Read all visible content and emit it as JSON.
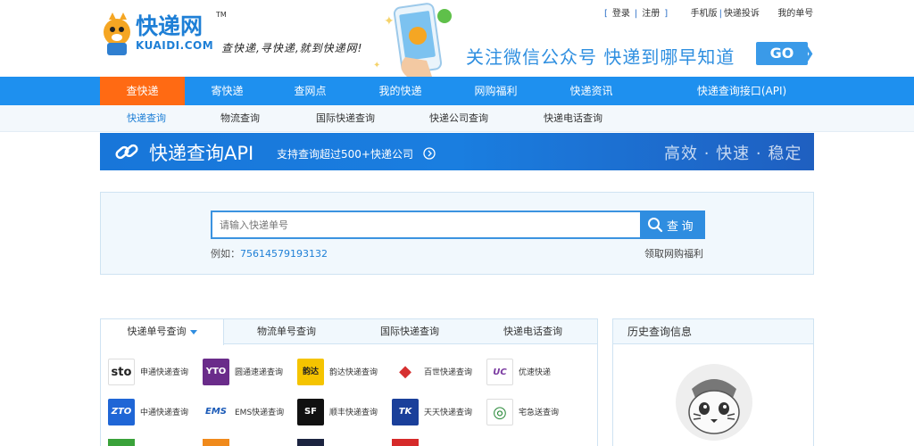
{
  "header": {
    "logo_text": "快递网",
    "logo_tm": "TM",
    "logo_sub": "KUAIDI.COM",
    "slogan": "查快递,寻快递,就到快递网!",
    "top_links": {
      "login": "登录",
      "register": "注册",
      "mobile": "手机版",
      "complaint": "快递投诉",
      "my_orders": "我的单号"
    },
    "banner_text": "关注微信公众号 快递到哪早知道",
    "banner_go": "GO"
  },
  "nav": [
    {
      "label": "查快递",
      "active": true
    },
    {
      "label": "寄快递"
    },
    {
      "label": "查网点"
    },
    {
      "label": "我的快递"
    },
    {
      "label": "网购福利"
    },
    {
      "label": "快递资讯"
    },
    {
      "label": "快递查询接口(API)"
    }
  ],
  "subnav": [
    {
      "label": "快递查询",
      "active": true
    },
    {
      "label": "物流查询"
    },
    {
      "label": "国际快递查询"
    },
    {
      "label": "快递公司查询"
    },
    {
      "label": "快递电话查询"
    }
  ],
  "api_banner": {
    "title": "快递查询API",
    "subtitle": "支持查询超过500+快递公司",
    "right_text": "高效 · 快速 · 稳定"
  },
  "search": {
    "placeholder": "请输入快递单号",
    "button": "查 询",
    "example_label": "例如：",
    "example_number": "75614579193132",
    "coupon_link": "领取网购福利"
  },
  "tabs": [
    {
      "label": "快递单号查询",
      "active": true
    },
    {
      "label": "物流单号查询"
    },
    {
      "label": "国际快递查询"
    },
    {
      "label": "快递电话查询"
    }
  ],
  "couriers": [
    {
      "name": "申通快递查询",
      "icon_text": "sto",
      "color": "#ffffff",
      "fg": "#222222"
    },
    {
      "name": "圆通速递查询",
      "icon_text": "YTO",
      "color": "#6a2c8a",
      "fg": "#ffffff"
    },
    {
      "name": "韵达快递查询",
      "icon_text": "韵达",
      "color": "#f5c400",
      "fg": "#222222"
    },
    {
      "name": "百世快递查询",
      "icon_text": "◆",
      "color": "#ffffff",
      "fg": "#d63030"
    },
    {
      "name": "优速快递",
      "icon_text": "UC",
      "color": "#ffffff",
      "fg": "#7a3aa0"
    },
    {
      "name": "中通快递查询",
      "icon_text": "ZTO",
      "color": "#1f66d6",
      "fg": "#ffffff"
    },
    {
      "name": "EMS快递查询",
      "icon_text": "EMS",
      "color": "#ffffff",
      "fg": "#1c5bb8"
    },
    {
      "name": "顺丰快递查询",
      "icon_text": "SF",
      "color": "#111111",
      "fg": "#ffffff"
    },
    {
      "name": "天天快递查询",
      "icon_text": "TK",
      "color": "#1a3f9a",
      "fg": "#ffffff"
    },
    {
      "name": "宅急送查询",
      "icon_text": "◎",
      "color": "#ffffff",
      "fg": "#2a8a3a"
    }
  ],
  "history": {
    "title": "历史查询信息"
  },
  "colors": {
    "primary_blue": "#1e90ef",
    "active_orange": "#ff6a13",
    "link_blue": "#1e7fd6"
  }
}
